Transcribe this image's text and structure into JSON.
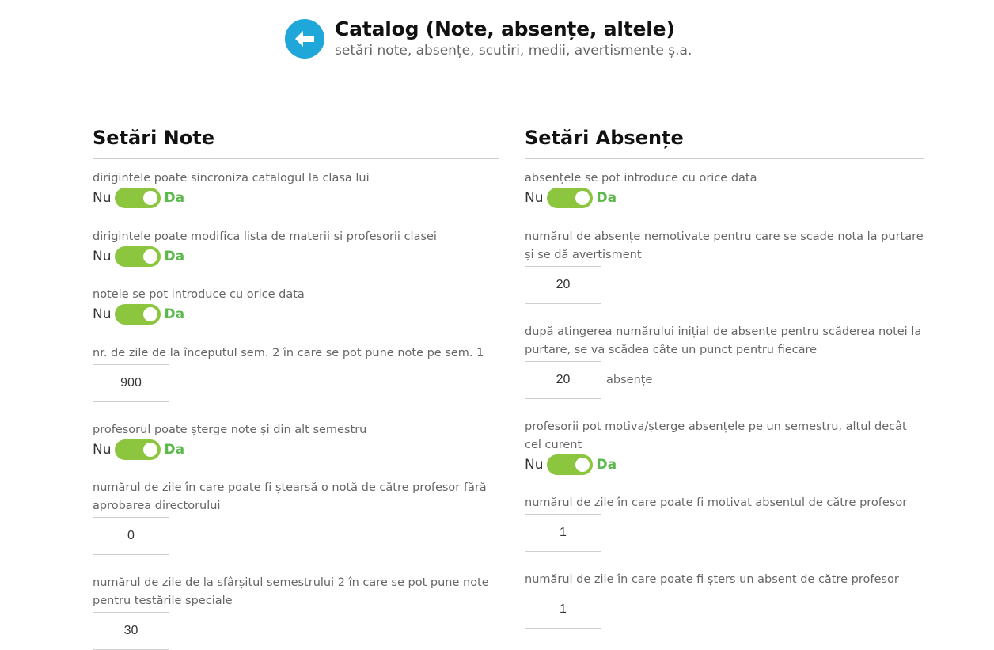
{
  "header": {
    "title": "Catalog (Note, absențe, altele)",
    "subtitle": "setări note, absențe, scutiri, medii, avertismente ș.a.",
    "back_icon": "arrow-left-icon",
    "accent_color": "#1ea7d8"
  },
  "toggle_labels": {
    "off": "Nu",
    "on": "Da"
  },
  "colors": {
    "toggle_on": "#8cc63e",
    "da_text": "#5bb84b"
  },
  "note_settings": {
    "title": "Setări Note",
    "items": [
      {
        "label": "dirigintele poate sincroniza catalogul la clasa lui",
        "type": "toggle",
        "value": true
      },
      {
        "label": "dirigintele poate modifica lista de materii si profesorii clasei",
        "type": "toggle",
        "value": true
      },
      {
        "label": "notele se pot introduce cu orice data",
        "type": "toggle",
        "value": true
      },
      {
        "label": "nr. de zile de la începutul sem. 2 în care se pot pune note pe sem. 1",
        "type": "number",
        "value": "900"
      },
      {
        "label": "profesorul poate șterge note și din alt semestru",
        "type": "toggle",
        "value": true
      },
      {
        "label": "numărul de zile în care poate fi ștearsă o notă de către profesor fără aprobarea directorului",
        "type": "number",
        "value": "0"
      },
      {
        "label": "numărul de zile de la sfârșitul semestrului 2 în care se pot pune note pentru testările speciale",
        "type": "number",
        "value": "30"
      }
    ]
  },
  "absence_settings": {
    "title": "Setări Absențe",
    "items": [
      {
        "label": "absențele se pot introduce cu orice data",
        "type": "toggle",
        "value": true
      },
      {
        "label": "numărul de absențe nemotivate pentru care se scade nota la purtare și se dă avertisment",
        "type": "number",
        "value": "20"
      },
      {
        "label": "după atingerea numărului inițial de absențe pentru scăderea notei la purtare, se va scădea câte un punct pentru fiecare",
        "type": "number",
        "value": "20",
        "suffix": "absențe"
      },
      {
        "label": "profesorii pot motiva/șterge absențele pe un semestru, altul decât cel curent",
        "type": "toggle",
        "value": true
      },
      {
        "label": "numărul de zile în care poate fi motivat absentul de către profesor",
        "type": "number",
        "value": "1"
      },
      {
        "label": "numărul de zile în care poate fi șters un absent de către profesor",
        "type": "number",
        "value": "1"
      }
    ]
  }
}
